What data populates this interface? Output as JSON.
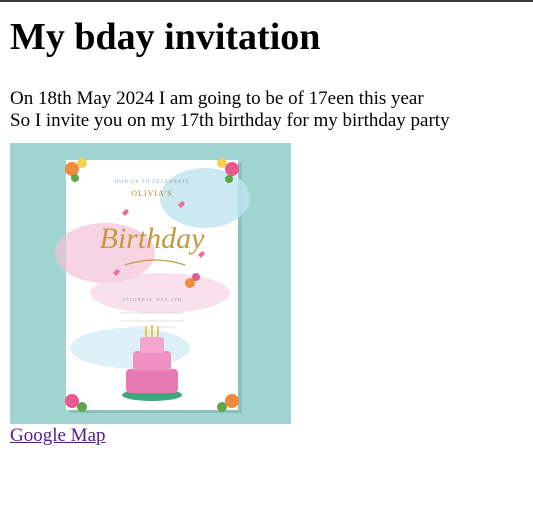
{
  "page": {
    "title": "My bday invitation",
    "line1": "On 18th May 2024 I am going to be of 17een this year",
    "line2": "So I invite you on my 17th birthday for my birthday party",
    "link_label": "Google Map"
  },
  "invitation_card": {
    "heading_small": "JOIN US TO CELEBRATE",
    "name": "OLIVIA'S",
    "script": "Birthday",
    "date_line": "SATURDAY MAY 4TH",
    "colors": {
      "background": "#a0d4d0",
      "card": "#ffffff",
      "gold": "#c49a3c",
      "pink_wash": "#f3c2d6",
      "blue_wash": "#bfe3ef",
      "cake_pink": "#e779b5",
      "link": "#551a8b"
    }
  }
}
